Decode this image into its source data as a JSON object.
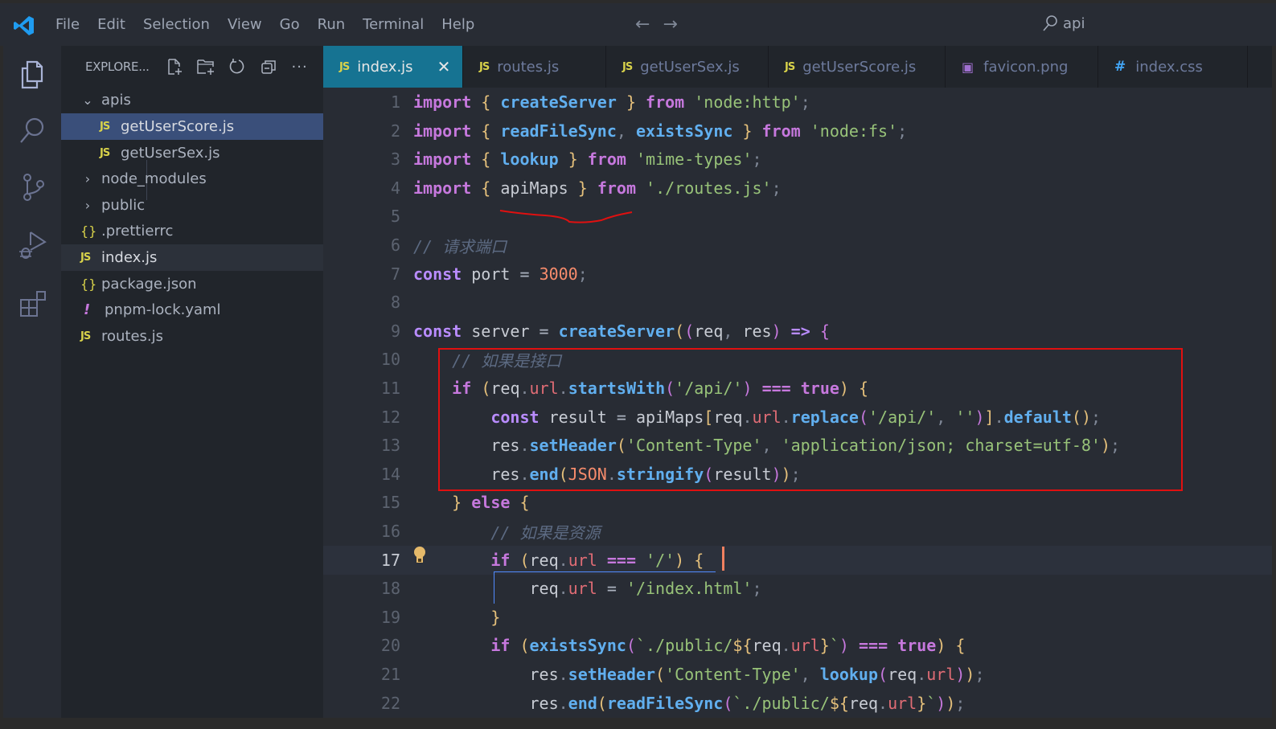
{
  "titlebar": {
    "menu": [
      "File",
      "Edit",
      "Selection",
      "View",
      "Go",
      "Run",
      "Terminal",
      "Help"
    ],
    "search_text": "api",
    "back_icon": "arrow-left-icon",
    "forward_icon": "arrow-right-icon"
  },
  "activitybar": {
    "items": [
      "explorer-icon",
      "search-icon",
      "source-control-icon",
      "run-debug-icon",
      "extensions-icon"
    ]
  },
  "explorer": {
    "title": "EXPLORE...",
    "actions": [
      "new-file-icon",
      "new-folder-icon",
      "refresh-icon",
      "collapse-all-icon",
      "more-icon"
    ],
    "tree": [
      {
        "label": "apis",
        "type": "folder",
        "expanded": true,
        "depth": 0
      },
      {
        "label": "getUserScore.js",
        "type": "js",
        "depth": 1,
        "state": "selected"
      },
      {
        "label": "getUserSex.js",
        "type": "js",
        "depth": 1
      },
      {
        "label": "node_modules",
        "type": "folder",
        "expanded": false,
        "depth": 0
      },
      {
        "label": "public",
        "type": "folder",
        "expanded": false,
        "depth": 0
      },
      {
        "label": ".prettierrc",
        "type": "json",
        "depth": 0
      },
      {
        "label": "index.js",
        "type": "js",
        "depth": 0,
        "state": "active"
      },
      {
        "label": "package.json",
        "type": "json",
        "depth": 0
      },
      {
        "label": "pnpm-lock.yaml",
        "type": "yaml",
        "depth": 0
      },
      {
        "label": "routes.js",
        "type": "js",
        "depth": 0
      }
    ]
  },
  "tabs": [
    {
      "label": "index.js",
      "icon": "JS",
      "active": true
    },
    {
      "label": "routes.js",
      "icon": "JS"
    },
    {
      "label": "getUserSex.js",
      "icon": "JS"
    },
    {
      "label": "getUserScore.js",
      "icon": "JS"
    },
    {
      "label": "favicon.png",
      "icon": "image"
    },
    {
      "label": "index.css",
      "icon": "#"
    }
  ],
  "icon_labels": {
    "js": "JS",
    "json": "{}",
    "yaml": "!",
    "css": "#"
  },
  "editor": {
    "current_line": 17,
    "lines": [
      {
        "n": 1,
        "text": "import { createServer } from 'node:http';"
      },
      {
        "n": 2,
        "text": "import { readFileSync, existsSync } from 'node:fs';"
      },
      {
        "n": 3,
        "text": "import { lookup } from 'mime-types';"
      },
      {
        "n": 4,
        "text": "import { apiMaps } from './routes.js';"
      },
      {
        "n": 5,
        "text": ""
      },
      {
        "n": 6,
        "text": "// 请求端口"
      },
      {
        "n": 7,
        "text": "const port = 3000;"
      },
      {
        "n": 8,
        "text": ""
      },
      {
        "n": 9,
        "text": "const server = createServer((req, res) => {"
      },
      {
        "n": 10,
        "text": "    // 如果是接口"
      },
      {
        "n": 11,
        "text": "    if (req.url.startsWith('/api/') === true) {"
      },
      {
        "n": 12,
        "text": "        const result = apiMaps[req.url.replace('/api/', '')].default();"
      },
      {
        "n": 13,
        "text": "        res.setHeader('Content-Type', 'application/json; charset=utf-8');"
      },
      {
        "n": 14,
        "text": "        res.end(JSON.stringify(result));"
      },
      {
        "n": 15,
        "text": "    } else {"
      },
      {
        "n": 16,
        "text": "        // 如果是资源"
      },
      {
        "n": 17,
        "text": "        if (req.url === '/') {"
      },
      {
        "n": 18,
        "text": "            req.url = '/index.html';"
      },
      {
        "n": 19,
        "text": "        }"
      },
      {
        "n": 20,
        "text": "        if (existsSync(`./public/${req.url}`) === true) {"
      },
      {
        "n": 21,
        "text": "            res.setHeader('Content-Type', lookup(req.url));"
      },
      {
        "n": 22,
        "text": "            res.end(readFileSync(`./public/${req.url}`));"
      }
    ]
  },
  "annotations": {
    "highlight_box_lines": [
      10,
      14
    ],
    "underline_target": "apiMaps",
    "color": "#e01010"
  },
  "colors": {
    "active_tab": "#167392",
    "selected_item": "#3a4f7a",
    "keyword": "#c678dd",
    "function": "#61afef",
    "string": "#98c379",
    "number": "#f78c6c",
    "property": "#e06c75"
  }
}
